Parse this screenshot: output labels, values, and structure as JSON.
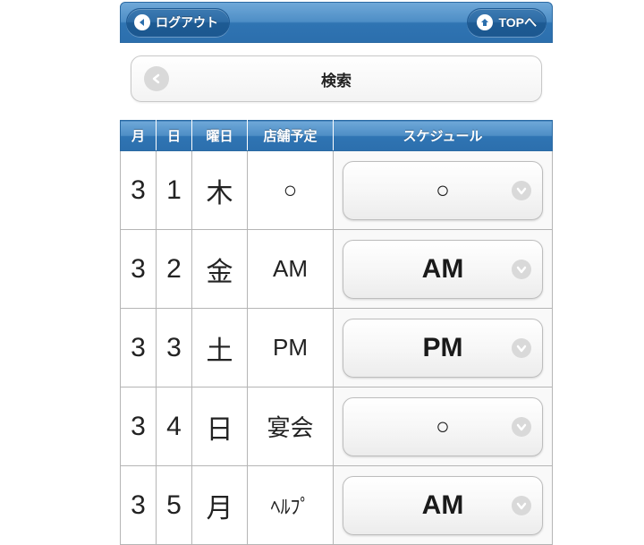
{
  "nav": {
    "logout_label": "ログアウト",
    "top_label": "TOPへ"
  },
  "search": {
    "label": "検索"
  },
  "table": {
    "headers": {
      "month": "月",
      "day": "日",
      "weekday": "曜日",
      "plan": "店舗予定",
      "schedule": "スケジュール"
    },
    "rows": [
      {
        "month": "3",
        "day": "1",
        "weekday": "木",
        "plan": "○",
        "schedule": "○"
      },
      {
        "month": "3",
        "day": "2",
        "weekday": "金",
        "plan": "AM",
        "schedule": "AM"
      },
      {
        "month": "3",
        "day": "3",
        "weekday": "土",
        "plan": "PM",
        "schedule": "PM"
      },
      {
        "month": "3",
        "day": "4",
        "weekday": "日",
        "plan": "宴会",
        "schedule": "○"
      },
      {
        "month": "3",
        "day": "5",
        "weekday": "月",
        "plan": "ﾍﾙﾌﾟ",
        "schedule": "AM"
      }
    ]
  }
}
